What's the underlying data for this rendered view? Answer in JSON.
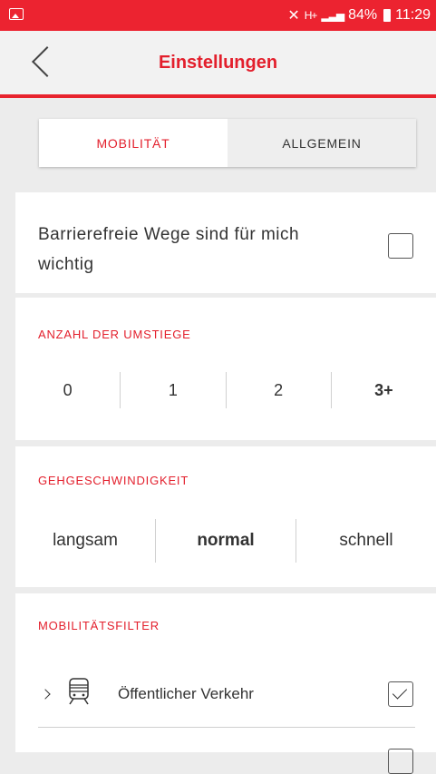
{
  "status_bar": {
    "network": "H+",
    "battery": "84%",
    "time": "11:29"
  },
  "app_bar": {
    "title": "Einstellungen"
  },
  "tabs": [
    {
      "label": "MOBILITÄT",
      "active": true
    },
    {
      "label": "ALLGEMEIN",
      "active": false
    }
  ],
  "barrier_free": {
    "label": "Barrierefreie Wege sind für mich wichtig",
    "checked": false
  },
  "transfers": {
    "heading": "ANZAHL DER UMSTIEGE",
    "options": [
      "0",
      "1",
      "2",
      "3+"
    ],
    "selected": "3+"
  },
  "walking_speed": {
    "heading": "GEHGESCHWINDIGKEIT",
    "options": [
      "langsam",
      "normal",
      "schnell"
    ],
    "selected": "normal"
  },
  "mobility_filter": {
    "heading": "MOBILITÄTSFILTER",
    "items": [
      {
        "label": "Öffentlicher Verkehr",
        "icon": "train-icon",
        "checked": true
      }
    ]
  },
  "colors": {
    "accent": "#e31f2c",
    "status_bar": "#ec2330"
  }
}
